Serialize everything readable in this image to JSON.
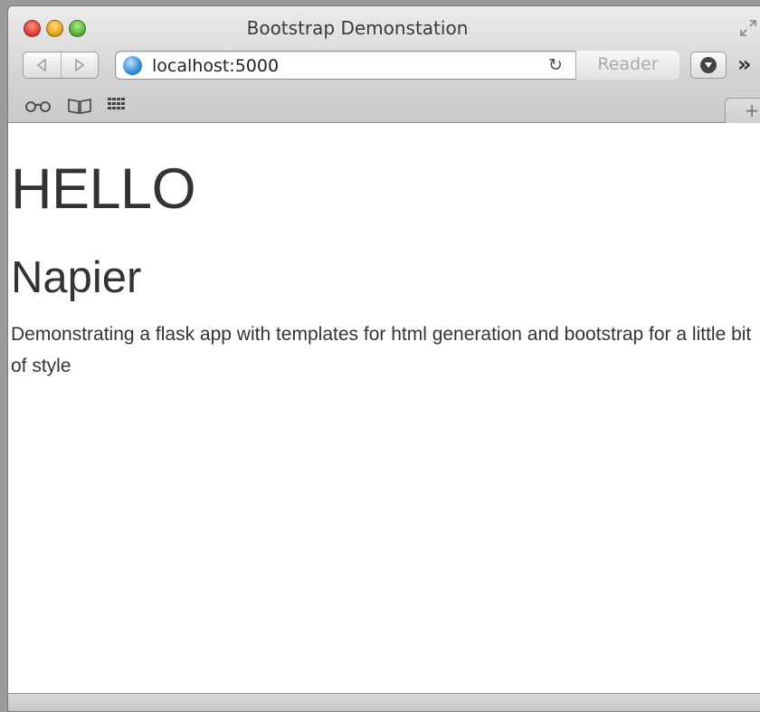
{
  "window": {
    "title": "Bootstrap Demonstation"
  },
  "toolbar": {
    "url": "localhost:5000",
    "reload_glyph": "↻",
    "reader_label": "Reader",
    "more_glyph": "»",
    "new_tab_glyph": "+"
  },
  "bookmarks": {
    "items": [
      {
        "icon": "reading-list-icon",
        "glyph": "👓"
      },
      {
        "icon": "bookmarks-icon",
        "glyph": "📖"
      },
      {
        "icon": "top-sites-icon",
        "glyph": "▦"
      }
    ]
  },
  "page": {
    "heading": "HELLO",
    "subheading": "Napier",
    "paragraph": "Demonstrating a flask app with templates for html generation and bootstrap for a little bit of style"
  },
  "colors": {
    "text": "#333333",
    "close": "#e0443a",
    "minimize": "#e8a523",
    "zoom": "#5ab534"
  }
}
